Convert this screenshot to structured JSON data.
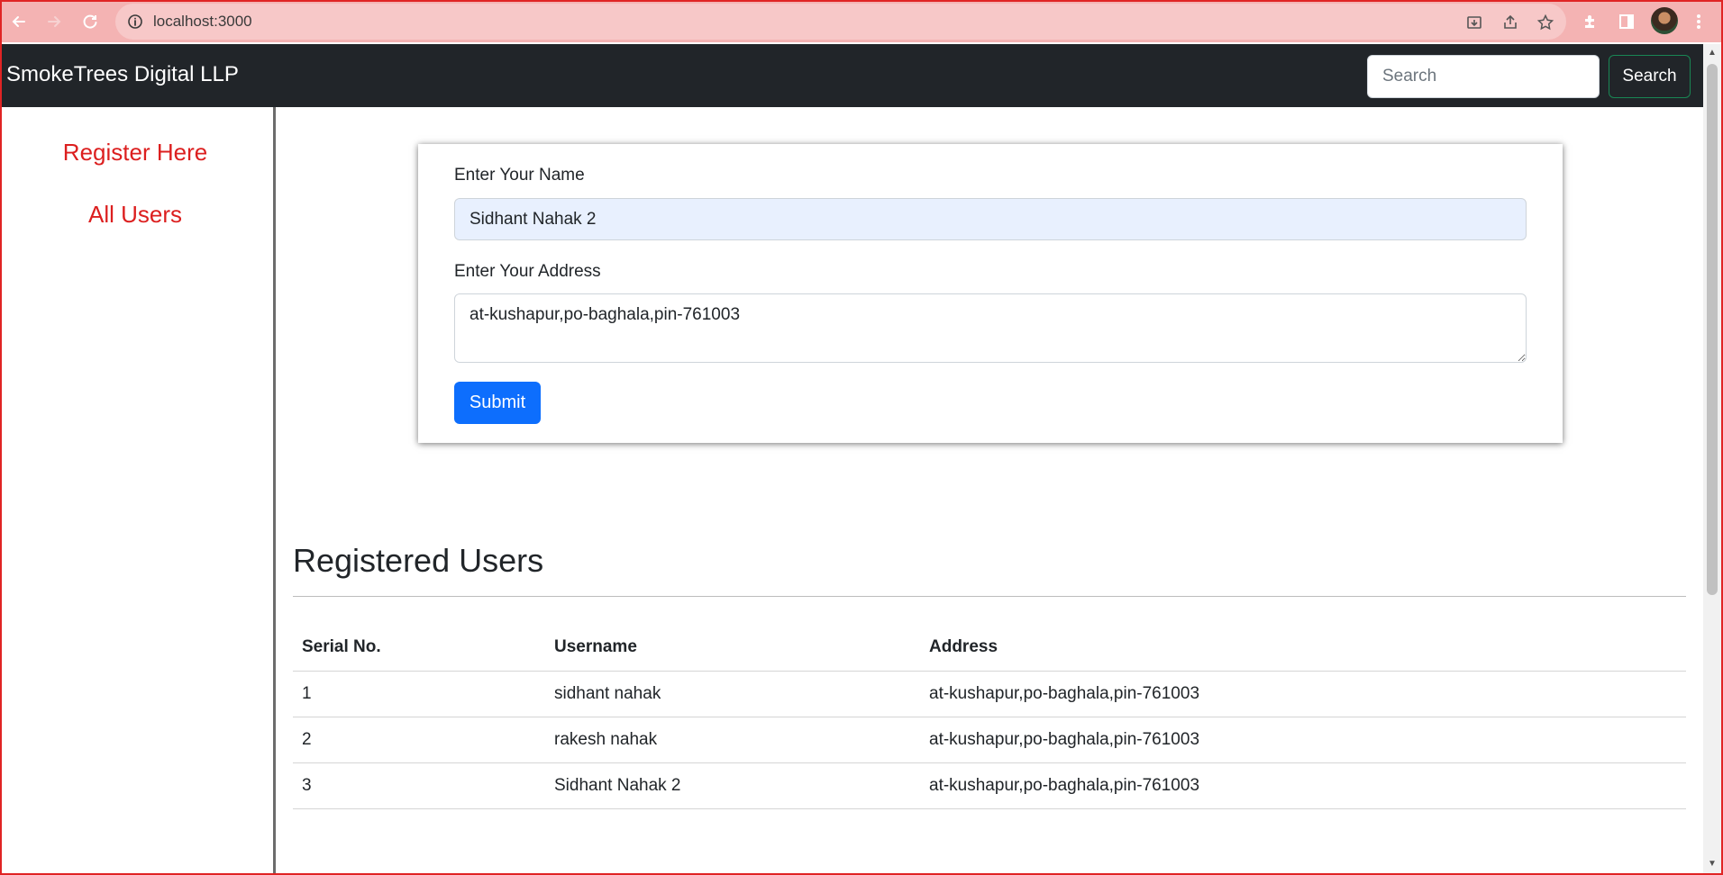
{
  "browser": {
    "url": "localhost:3000"
  },
  "navbar": {
    "brand": "SmokeTrees Digital LLP",
    "search_placeholder": "Search",
    "search_button": "Search",
    "accent_color": "#198754"
  },
  "sidebar": {
    "items": [
      {
        "label": "Register Here"
      },
      {
        "label": "All Users"
      }
    ],
    "link_color": "#dc1f1f"
  },
  "form": {
    "name_label": "Enter Your Name",
    "name_value": "Sidhant Nahak 2",
    "address_label": "Enter Your Address",
    "address_value": "at-kushapur,po-baghala,pin-761003",
    "submit_label": "Submit",
    "submit_color": "#0d6efd"
  },
  "users_section": {
    "title": "Registered Users",
    "columns": [
      "Serial No.",
      "Username",
      "Address"
    ],
    "rows": [
      [
        "1",
        "sidhant nahak",
        "at-kushapur,po-baghala,pin-761003"
      ],
      [
        "2",
        "rakesh nahak",
        "at-kushapur,po-baghala,pin-761003"
      ],
      [
        "3",
        "Sidhant Nahak 2",
        "at-kushapur,po-baghala,pin-761003"
      ]
    ]
  }
}
